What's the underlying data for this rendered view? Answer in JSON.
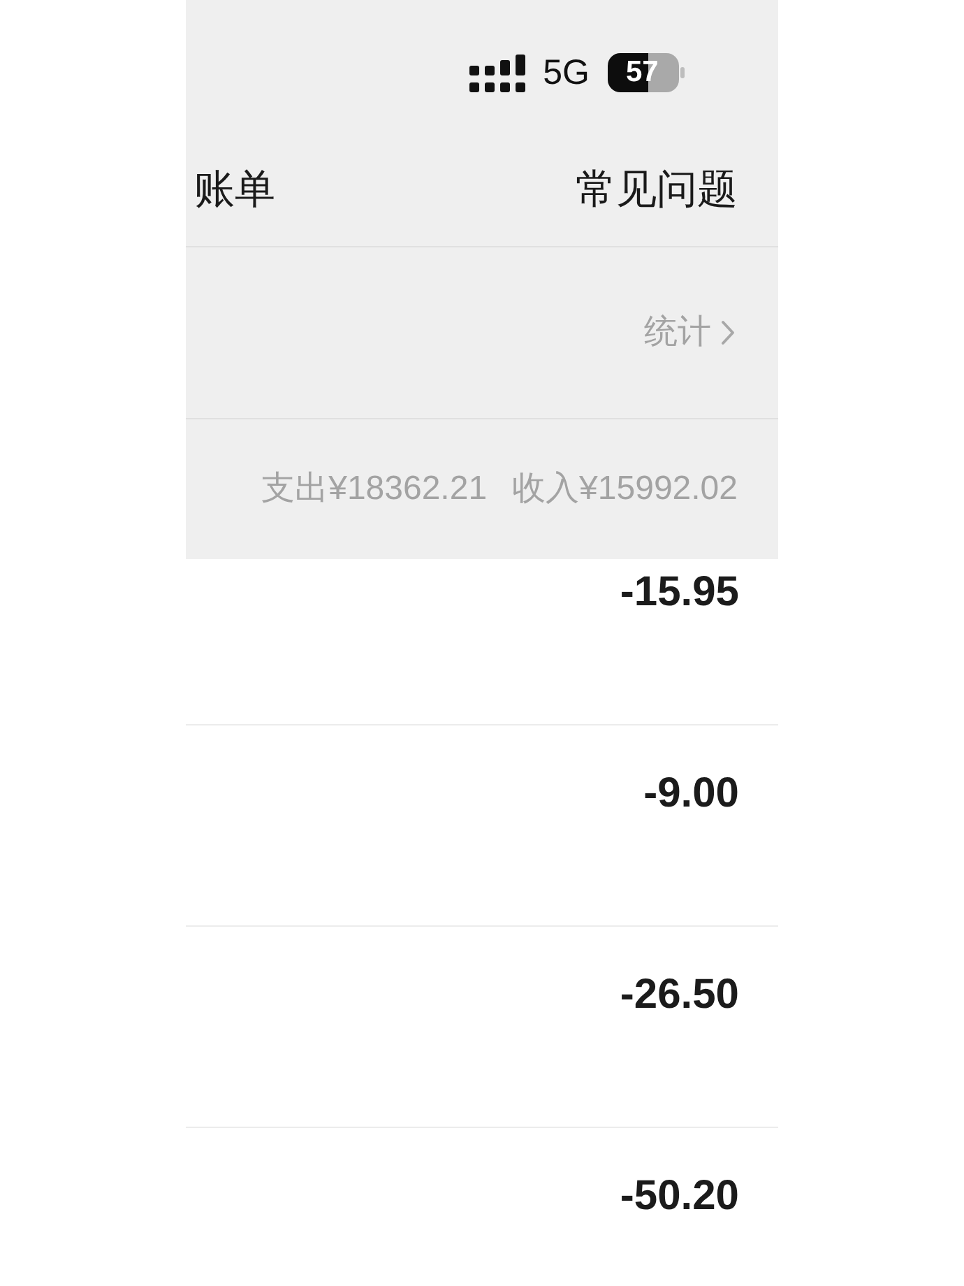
{
  "status_bar": {
    "network": "5G",
    "battery": "57"
  },
  "nav": {
    "title": "账单",
    "link": "常见问题"
  },
  "stats_link": {
    "label": "统计"
  },
  "summary": {
    "expense": "支出¥18362.21",
    "income": "收入¥15992.02"
  },
  "transactions": [
    {
      "amount": "-15.95"
    },
    {
      "amount": "-9.00"
    },
    {
      "amount": "-26.50"
    },
    {
      "amount": "-50.20"
    }
  ]
}
